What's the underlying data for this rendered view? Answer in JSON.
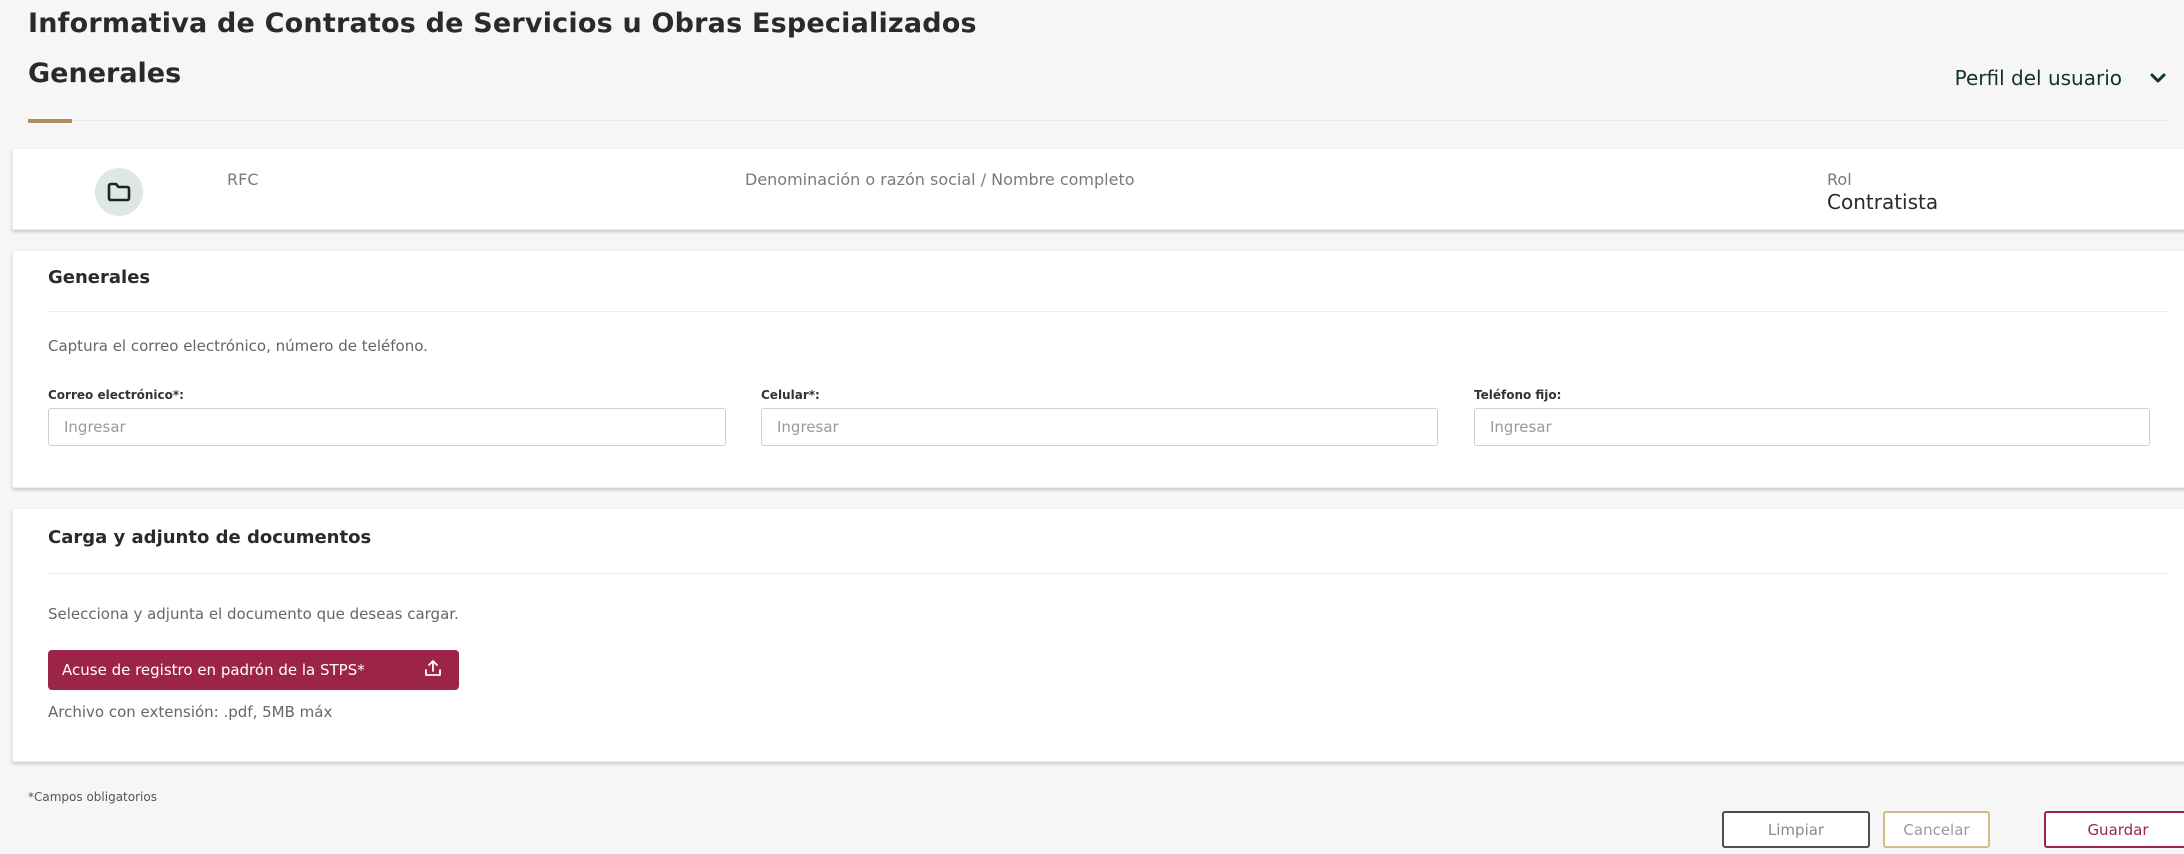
{
  "header": {
    "page_title": "Informativa de Contratos de Servicios u Obras Especializados",
    "section_title": "Generales",
    "profile_toggle_label": "Perfil del usuario",
    "accent_color": "#b38e5d"
  },
  "user_card": {
    "icon": "folder-icon",
    "rfc_label": "RFC",
    "rfc_value": "",
    "razon_label": "Denominación o razón social / Nombre completo",
    "razon_value": "",
    "rol_label": "Rol",
    "rol_value": "Contratista"
  },
  "generales": {
    "heading": "Generales",
    "description": "Captura el correo electrónico, número de teléfono.",
    "fields": [
      {
        "label": "Correo electrónico*:",
        "placeholder": "Ingresar",
        "value": ""
      },
      {
        "label": "Celular*:",
        "placeholder": "Ingresar",
        "value": ""
      },
      {
        "label": "Teléfono fijo:",
        "placeholder": "Ingresar",
        "value": ""
      }
    ]
  },
  "documents": {
    "heading": "Carga y adjunto de documentos",
    "description": "Selecciona y adjunta el documento que deseas cargar.",
    "upload_button_label": "Acuse de registro en padrón de la STPS*",
    "upload_icon": "upload-icon",
    "upload_hint": "Archivo con extensión: .pdf, 5MB máx",
    "button_color": "#9d2449"
  },
  "footer": {
    "required_note": "*Campos obligatorios",
    "buttons": {
      "clear": "Limpiar",
      "cancel": "Cancelar",
      "save": "Guardar"
    }
  }
}
